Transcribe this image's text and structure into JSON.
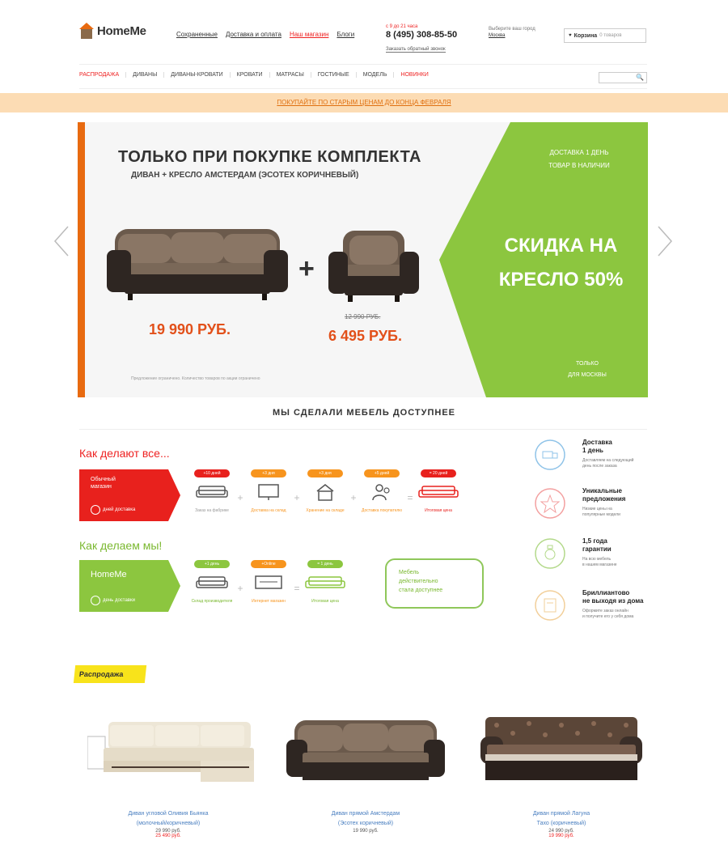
{
  "header": {
    "logo_text": "HomeMe",
    "nav": [
      "Сохраненные",
      "Доставка и оплата",
      "Наш магазин",
      "Блоги"
    ],
    "phone": {
      "top": "с 9 до 21 часа",
      "number": "8 (495) 308-85-50",
      "sub": "Заказать обратный звонок"
    },
    "city": {
      "label": "Выберите ваш город",
      "value": "Москва"
    },
    "cart": {
      "label": "Корзина",
      "count": "0 товаров"
    }
  },
  "main_nav": {
    "items": [
      "РАСПРОДАЖА",
      "ДИВАНЫ",
      "ДИВАНЫ-КРОВАТИ",
      "КРОВАТИ",
      "МАТРАСЫ",
      "ГОСТИНЫЕ",
      "МОДЕЛЬ"
    ],
    "highlight": "НОВИНКИ"
  },
  "search": {
    "icon": "search-icon",
    "glyph": "🔍"
  },
  "promo": {
    "text": "ПОКУПАЙТЕ ПО СТАРЫМ ЦЕНАМ ДО КОНЦА ФЕВРАЛЯ"
  },
  "banner": {
    "title": "ТОЛЬКО ПРИ ПОКУПКЕ КОМПЛЕКТА",
    "subtitle": "ДИВАН + КРЕСЛО АМСТЕРДАМ (ЭСОТЕХ КОРИЧНЕВЫЙ)",
    "plus": "+",
    "price_sofa": "19 990 РУБ.",
    "price_chair_old": "12 990 РУБ.",
    "price_chair": "6 495 РУБ.",
    "note": "Предложение ограничено. Количество товаров по акции ограничено",
    "green_top": [
      "ДОСТАВКА 1 ДЕНЬ",
      "ТОВАР В НАЛИЧИИ"
    ],
    "green_big": [
      "СКИДКА НА",
      "КРЕСЛО 50%"
    ],
    "green_bottom": [
      "ТОЛЬКО",
      "ДЛЯ МОСКВЫ"
    ],
    "colors": {
      "orange": "#e86a10",
      "green": "#8cc63f",
      "price": "#e2501a"
    }
  },
  "section_title": "МЫ СДЕЛАЛИ МЕБЕЛЬ ДОСТУПНЕЕ",
  "how_others": {
    "title": "Как делают все...",
    "box_text": [
      "Обычный",
      "магазин"
    ],
    "box_sub": "дней доставка",
    "steps": [
      {
        "badge": "+10 дней",
        "caption": "Заказ на фабрике"
      },
      {
        "badge": "+3 дня",
        "caption": "Доставка на склад"
      },
      {
        "badge": "+3 дня",
        "caption": "Хранение на складе"
      },
      {
        "badge": "+5 дней",
        "caption": "Доставка покупателю"
      },
      {
        "badge": "= 20 дней",
        "caption": "Итоговая цена"
      }
    ]
  },
  "how_we": {
    "title": "Как делаем мы!",
    "box_text": [
      "HomeMe"
    ],
    "box_sub": "день доставки",
    "steps": [
      {
        "badge": "+1 день",
        "caption": "Склад производителя"
      },
      {
        "badge": "+Online",
        "caption": "Интернет магазин"
      },
      {
        "badge": "= 1 день",
        "caption": "Итоговая цена"
      }
    ],
    "bubble": [
      "Мебель",
      "действительно",
      "стала доступнее"
    ]
  },
  "features": [
    {
      "icon": "delivery-icon",
      "title": [
        "Доставка",
        "1 день"
      ],
      "text": [
        "Доставляем на следующий",
        "день после заказа"
      ]
    },
    {
      "icon": "star-icon",
      "title": [
        "Уникальные",
        "предложения"
      ],
      "text": [
        "Низкие цены на",
        "популярные модели"
      ]
    },
    {
      "icon": "warranty-icon",
      "title": [
        "1,5 года",
        "гарантии"
      ],
      "text": [
        "На всю мебель",
        "в нашем магазине"
      ]
    },
    {
      "icon": "home-icon",
      "title": [
        "Бриллиантово",
        "не выходя из дома"
      ],
      "text": [
        "Оформите заказ онлайн",
        "и получите его у себя дома"
      ]
    }
  ],
  "sale": {
    "label": "Распродажа",
    "products": [
      {
        "name": [
          "Диван угловой Оливия Бьянка",
          "(молочный/коричневый)"
        ],
        "price": "29 990 руб.",
        "sale": "25 490 руб."
      },
      {
        "name": [
          "Диван прямой Амстердам",
          "(Эсотех коричневый)"
        ],
        "price": "19 990 руб.",
        "sale": ""
      },
      {
        "name": [
          "Диван прямой Лагуна",
          "Тахо (коричневый)"
        ],
        "price": "24 990 руб.",
        "sale": "19 990 руб."
      }
    ]
  }
}
